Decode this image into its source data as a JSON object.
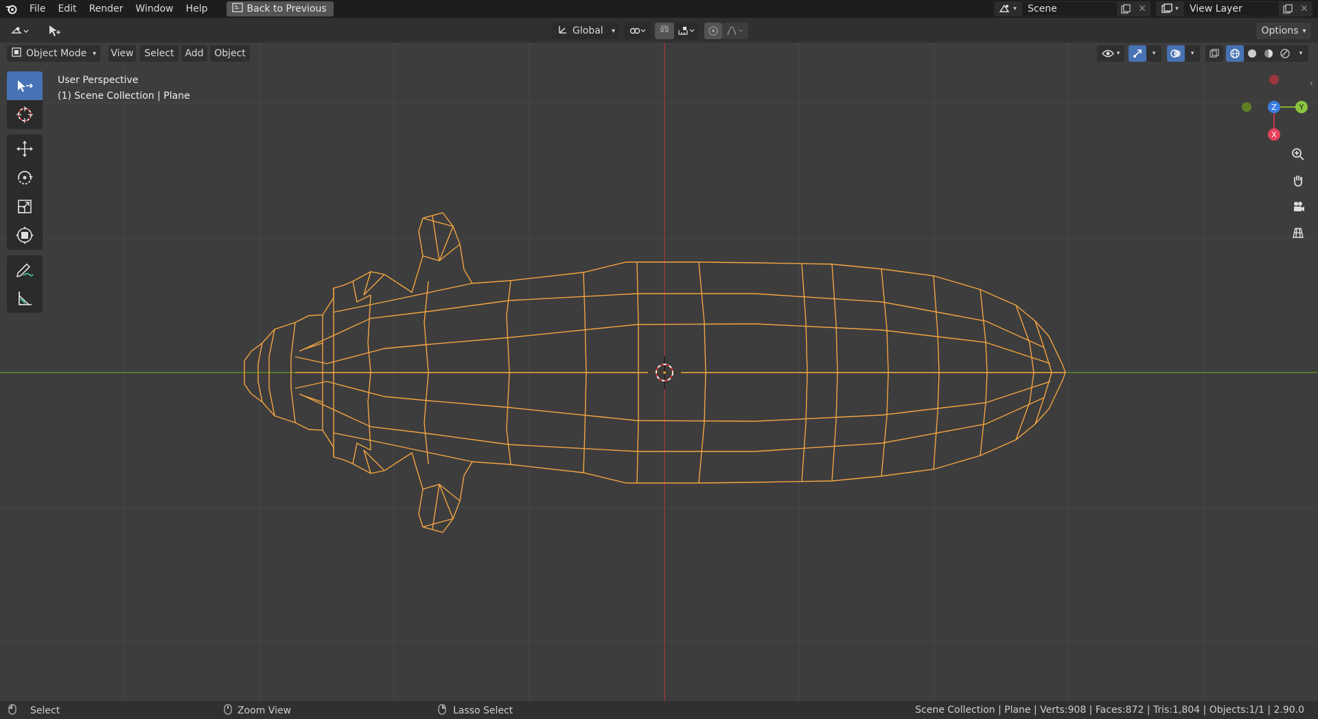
{
  "menu": {
    "items": [
      "File",
      "Edit",
      "Render",
      "Window",
      "Help"
    ],
    "back_button": "Back to Previous"
  },
  "scene": {
    "label": "Scene"
  },
  "view_layer": {
    "label": "View Layer"
  },
  "header": {
    "transform_orientation": "Global",
    "options": "Options",
    "mode": "Object Mode",
    "view_menu": [
      "View",
      "Select",
      "Add",
      "Object"
    ]
  },
  "viewport": {
    "perspective": "User Perspective",
    "collection": "(1) Scene Collection | Plane",
    "gizmo_axes": {
      "z": "Z",
      "y": "Y",
      "x": "X"
    },
    "colors": {
      "wire": "#f5a542",
      "x_axis": "#c8344a",
      "y_axis": "#6b9a27",
      "z_axis": "#3c7de0"
    }
  },
  "status": {
    "left_select": "Select",
    "zoom": "Zoom View",
    "lasso": "Lasso Select",
    "stats": "Scene Collection | Plane | Verts:908 | Faces:872 | Tris:1,804 | Objects:1/1 | 2.90.0"
  },
  "icons": [
    "blender-logo",
    "editor-type-icon",
    "select-box-icon",
    "cursor-icon",
    "move-icon",
    "rotate-icon",
    "scale-icon",
    "transform-icon",
    "annotate-icon",
    "measure-icon",
    "zoom-icon",
    "hand-icon",
    "camera-icon",
    "grid-icon"
  ]
}
